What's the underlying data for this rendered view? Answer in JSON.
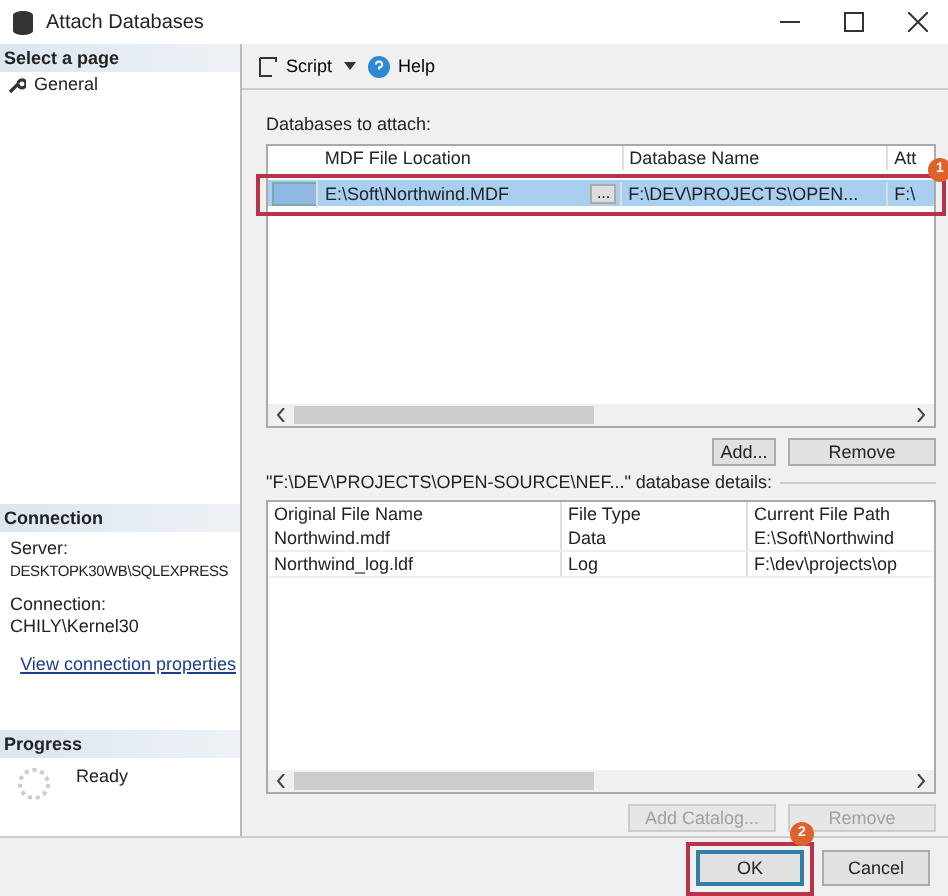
{
  "window": {
    "title": "Attach Databases"
  },
  "sidebar": {
    "heading": "Select a page",
    "items": [
      {
        "label": "General"
      }
    ]
  },
  "connection": {
    "heading": "Connection",
    "server_label": "Server:",
    "server": "DESKTOPK30WB\\SQLEXPRESS",
    "connection_label": "Connection:",
    "connection": "CHILY\\Kernel30",
    "link": "View connection properties"
  },
  "progress": {
    "heading": "Progress",
    "status": "Ready"
  },
  "toolbar": {
    "script": "Script",
    "help": "Help"
  },
  "attach": {
    "label": "Databases to attach:",
    "columns": [
      "MDF File Location",
      "Database Name",
      "Att"
    ],
    "rows": [
      {
        "location": "E:\\Soft\\Northwind.MDF",
        "browse": "...",
        "database_name": "F:\\DEV\\PROJECTS\\OPEN...",
        "column_3": "F:\\",
        "selected": true
      }
    ],
    "callout": "1",
    "buttons": [
      {
        "label": "Add...",
        "disabled": false
      },
      {
        "label": "Remove",
        "disabled": false
      }
    ]
  },
  "details": {
    "label": "\"F:\\DEV\\PROJECTS\\OPEN-SOURCE\\NEF...\" database details:",
    "columns": [
      "Original File Name",
      "File Type",
      "Current File Path"
    ],
    "rows": [
      {
        "name": "Northwind.mdf",
        "type": "Data",
        "path": "E:\\Soft\\Northwind"
      },
      {
        "name": "Northwind_log.ldf",
        "type": "Log",
        "path": "F:\\dev\\projects\\op"
      }
    ],
    "buttons": [
      {
        "label": "Add Catalog...",
        "disabled": true
      },
      {
        "label": "Remove",
        "disabled": true
      }
    ]
  },
  "footer": {
    "buttons": [
      {
        "label": "OK",
        "default": true
      },
      {
        "label": "Cancel",
        "default": false
      }
    ],
    "callout": "2"
  }
}
